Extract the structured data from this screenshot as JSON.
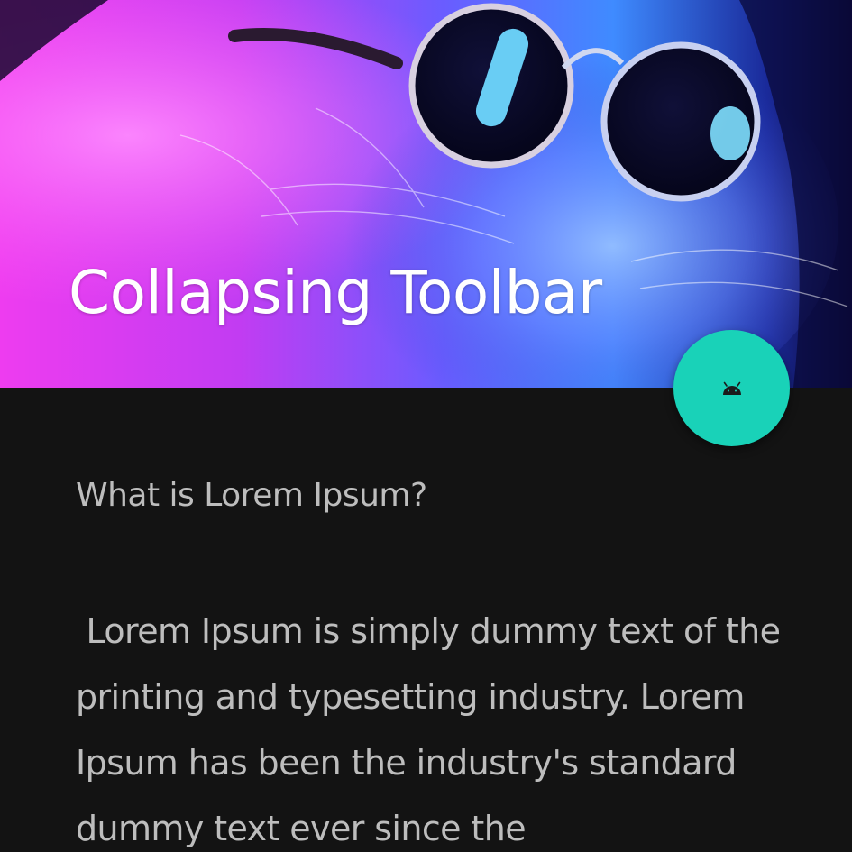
{
  "toolbar": {
    "title": "Collapsing Toolbar",
    "header_image": {
      "subject": "cat wearing round glowing sunglasses in pink and blue neon light",
      "colors": {
        "pink": "#e62ee6",
        "violet": "#7a3cf0",
        "blue": "#2f6bff",
        "dark": "#10063a"
      }
    }
  },
  "fab": {
    "icon": "android-icon",
    "color": "#19d2b8"
  },
  "content": {
    "heading": "What is Lorem Ipsum?",
    "body": " Lorem Ipsum is simply dummy text of the printing and typesetting industry. Lorem Ipsum has been the industry's standard dummy text ever since the"
  },
  "theme": {
    "background": "#131313",
    "text": "#bdbdbd",
    "title_text": "#ffffff"
  }
}
